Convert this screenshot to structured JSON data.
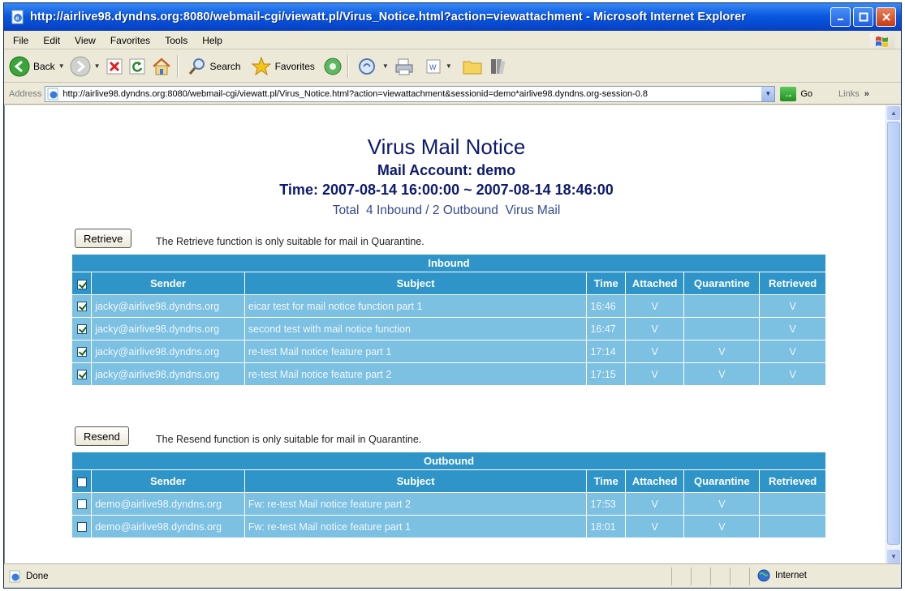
{
  "window": {
    "title": "http://airlive98.dyndns.org:8080/webmail-cgi/viewatt.pl/Virus_Notice.html?action=viewattachment - Microsoft Internet Explorer"
  },
  "menu": [
    "File",
    "Edit",
    "View",
    "Favorites",
    "Tools",
    "Help"
  ],
  "toolbar": {
    "back_label": "Back",
    "search_label": "Search",
    "favorites_label": "Favorites"
  },
  "address": {
    "label": "Address",
    "url": "http://airlive98.dyndns.org:8080/webmail-cgi/viewatt.pl/Virus_Notice.html?action=viewattachment&sessionid=demo*airlive98.dyndns.org-session-0.8",
    "go_label": "Go",
    "links_label": "Links"
  },
  "page": {
    "title": "Virus Mail Notice",
    "account": "Mail Account: demo",
    "time_range": "Time: 2007-08-14 16:00:00 ~ 2007-08-14 18:46:00",
    "total": "Total  4 Inbound / 2 Outbound  Virus Mail"
  },
  "inbound": {
    "button_label": "Retrieve",
    "note": "The Retrieve function is only suitable for mail in Quarantine.",
    "caption": "Inbound",
    "header_all_checked": true,
    "columns": [
      "Sender",
      "Subject",
      "Time",
      "Attached",
      "Quarantine",
      "Retrieved"
    ],
    "rows": [
      {
        "checked": true,
        "sender": "jacky@airlive98.dyndns.org",
        "subject": "eicar test for mail notice function part 1",
        "time": "16:46",
        "attached": "V",
        "quarantine": "",
        "retrieved": "V"
      },
      {
        "checked": true,
        "sender": "jacky@airlive98.dyndns.org",
        "subject": "second test with mail notice function",
        "time": "16:47",
        "attached": "V",
        "quarantine": "",
        "retrieved": "V"
      },
      {
        "checked": true,
        "sender": "jacky@airlive98.dyndns.org",
        "subject": "re-test Mail notice feature part 1",
        "time": "17:14",
        "attached": "V",
        "quarantine": "V",
        "retrieved": "V"
      },
      {
        "checked": true,
        "sender": "jacky@airlive98.dyndns.org",
        "subject": "re-test Mail notice feature part 2",
        "time": "17:15",
        "attached": "V",
        "quarantine": "V",
        "retrieved": "V"
      }
    ]
  },
  "outbound": {
    "button_label": "Resend",
    "note": "The Resend function is only suitable for mail in Quarantine.",
    "caption": "Outbound",
    "header_all_checked": false,
    "columns": [
      "Sender",
      "Subject",
      "Time",
      "Attached",
      "Quarantine",
      "Retrieved"
    ],
    "rows": [
      {
        "checked": false,
        "sender": "demo@airlive98.dyndns.org",
        "subject": "Fw: re-test Mail notice feature part 2",
        "time": "17:53",
        "attached": "V",
        "quarantine": "V",
        "retrieved": ""
      },
      {
        "checked": false,
        "sender": "demo@airlive98.dyndns.org",
        "subject": "Fw: re-test Mail notice feature part 1",
        "time": "18:01",
        "attached": "V",
        "quarantine": "V",
        "retrieved": ""
      }
    ]
  },
  "status": {
    "text": "Done",
    "zone": "Internet"
  },
  "colors": {
    "table_header": "#2f94c8",
    "table_row": "#7cc0e2",
    "title_text": "#0d1a6e"
  },
  "icons": [
    "ie-page-icon",
    "minimize-icon",
    "maximize-icon",
    "close-icon",
    "windows-flag-icon",
    "back-icon",
    "forward-icon",
    "stop-icon",
    "refresh-icon",
    "home-icon",
    "search-icon",
    "favorites-star-icon",
    "media-icon",
    "mail-icon",
    "print-icon",
    "edit-icon",
    "folder-icon",
    "research-icon",
    "go-icon",
    "globe-icon"
  ]
}
